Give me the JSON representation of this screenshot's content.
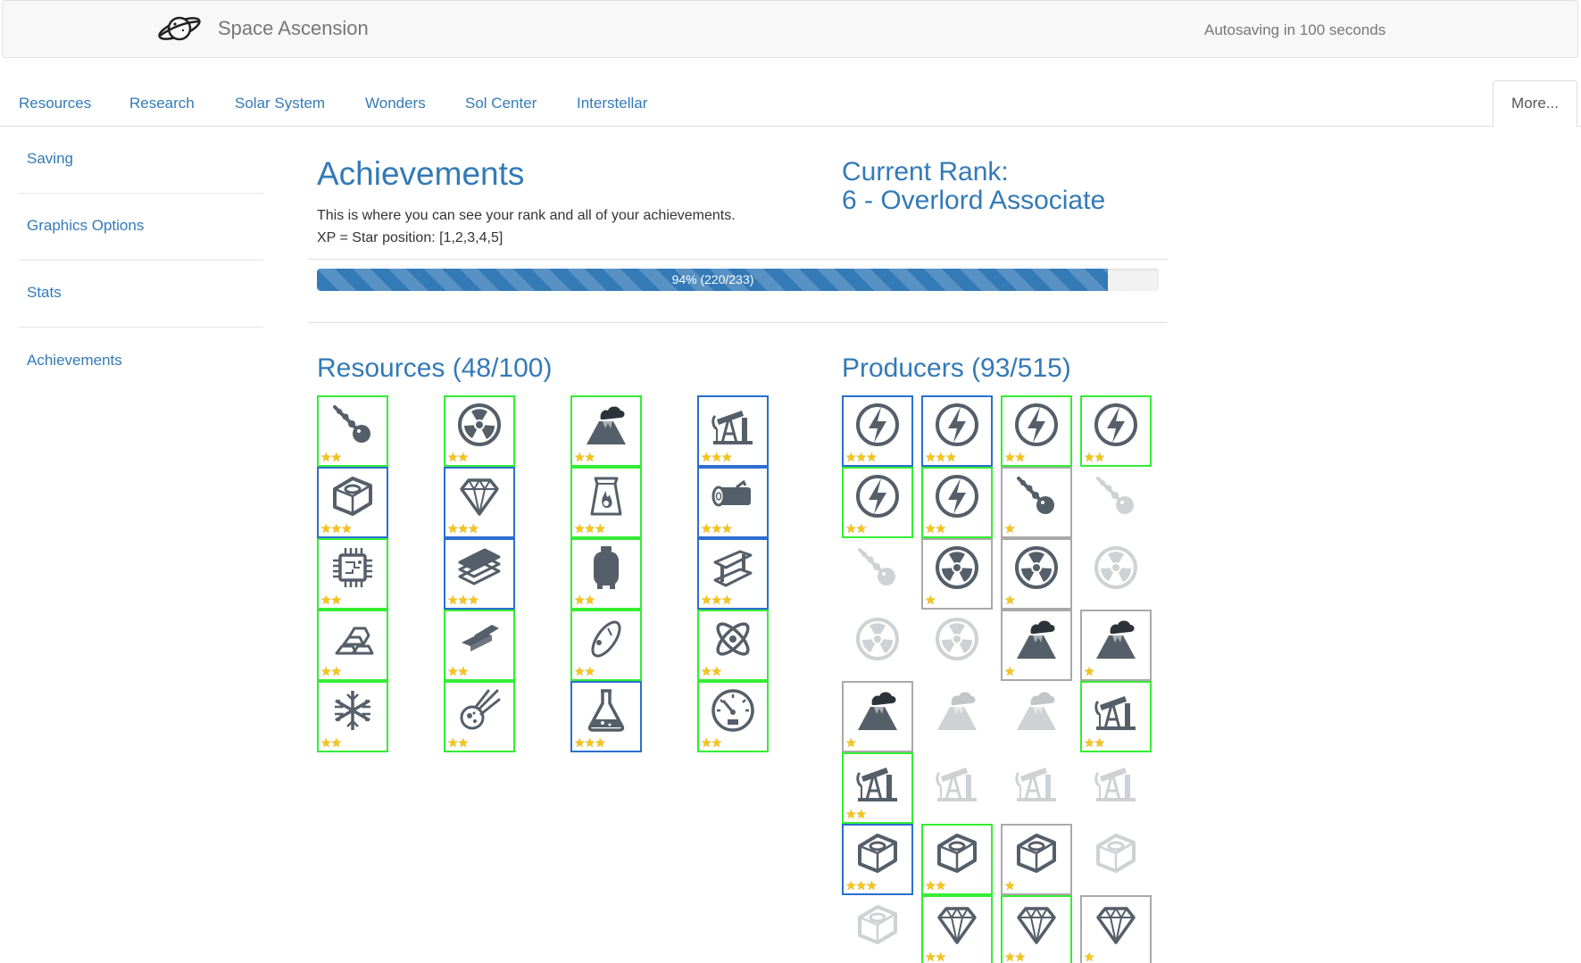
{
  "header": {
    "brand": "Space Ascension",
    "logo_icon": "planet-icon",
    "autosave": "Autosaving in 100 seconds"
  },
  "tabs": [
    {
      "label": "Resources"
    },
    {
      "label": "Research"
    },
    {
      "label": "Solar System"
    },
    {
      "label": "Wonders"
    },
    {
      "label": "Sol Center"
    },
    {
      "label": "Interstellar"
    }
  ],
  "tab_more": "More...",
  "sidebar": {
    "items": [
      {
        "label": "Saving"
      },
      {
        "label": "Graphics Options"
      },
      {
        "label": "Stats"
      },
      {
        "label": "Achievements"
      }
    ]
  },
  "achievements": {
    "title": "Achievements",
    "description": "This is where you can see your rank and all of your achievements.",
    "xp_note": "XP = Star position: [1,2,3,4,5]",
    "rank_label": "Current Rank:",
    "rank_value": "6 - Overlord Associate",
    "progress": {
      "fraction": 0.94,
      "text": "94% (220/233)"
    }
  },
  "resources": {
    "title": "Resources (48/100)",
    "items": [
      {
        "icon": "meteorite-icon",
        "stars": 2,
        "level": "green"
      },
      {
        "icon": "radiation-icon",
        "stars": 2,
        "level": "green"
      },
      {
        "icon": "volcano-icon",
        "stars": 2,
        "level": "green"
      },
      {
        "icon": "oil-pump-icon",
        "stars": 3,
        "level": "blue"
      },
      {
        "icon": "metal-nut-icon",
        "stars": 3,
        "level": "blue"
      },
      {
        "icon": "gem-icon",
        "stars": 3,
        "level": "blue"
      },
      {
        "icon": "charcoal-bag-icon",
        "stars": 3,
        "level": "green"
      },
      {
        "icon": "wood-log-icon",
        "stars": 3,
        "level": "blue"
      },
      {
        "icon": "silicon-chip-icon",
        "stars": 2,
        "level": "green"
      },
      {
        "icon": "plastic-sheets-icon",
        "stars": 3,
        "level": "blue"
      },
      {
        "icon": "gas-tank-icon",
        "stars": 2,
        "level": "green"
      },
      {
        "icon": "steel-beam-icon",
        "stars": 3,
        "level": "blue"
      },
      {
        "icon": "gold-bars-icon",
        "stars": 2,
        "level": "green"
      },
      {
        "icon": "silver-bars-icon",
        "stars": 2,
        "level": "green"
      },
      {
        "icon": "space-orbit-icon",
        "stars": 2,
        "level": "green"
      },
      {
        "icon": "atom-icon",
        "stars": 2,
        "level": "green"
      },
      {
        "icon": "snowflake-icon",
        "stars": 2,
        "level": "green"
      },
      {
        "icon": "comet-icon",
        "stars": 2,
        "level": "green"
      },
      {
        "icon": "science-flask-icon",
        "stars": 3,
        "level": "blue"
      },
      {
        "icon": "gauge-icon",
        "stars": 2,
        "level": "green"
      }
    ]
  },
  "producers": {
    "title": "Producers (93/515)",
    "items": [
      {
        "icon": "energy-icon",
        "stars": 3,
        "level": "blue"
      },
      {
        "icon": "energy-icon",
        "stars": 3,
        "level": "blue"
      },
      {
        "icon": "energy-icon",
        "stars": 2,
        "level": "green"
      },
      {
        "icon": "energy-icon",
        "stars": 2,
        "level": "green"
      },
      {
        "icon": "energy-icon",
        "stars": 2,
        "level": "green"
      },
      {
        "icon": "energy-icon",
        "stars": 2,
        "level": "green"
      },
      {
        "icon": "meteorite-icon",
        "stars": 1,
        "level": "grey"
      },
      {
        "icon": "meteorite-icon",
        "stars": 0,
        "level": "none"
      },
      {
        "icon": "meteorite-icon",
        "stars": 0,
        "level": "none"
      },
      {
        "icon": "radiation-icon",
        "stars": 1,
        "level": "grey"
      },
      {
        "icon": "radiation-icon",
        "stars": 1,
        "level": "grey"
      },
      {
        "icon": "radiation-icon",
        "stars": 0,
        "level": "none"
      },
      {
        "icon": "radiation-icon",
        "stars": 0,
        "level": "none"
      },
      {
        "icon": "radiation-icon",
        "stars": 0,
        "level": "none"
      },
      {
        "icon": "volcano-icon",
        "stars": 1,
        "level": "grey"
      },
      {
        "icon": "volcano-icon",
        "stars": 1,
        "level": "grey"
      },
      {
        "icon": "volcano-icon",
        "stars": 1,
        "level": "grey"
      },
      {
        "icon": "volcano-icon",
        "stars": 0,
        "level": "none"
      },
      {
        "icon": "volcano-icon",
        "stars": 0,
        "level": "none"
      },
      {
        "icon": "oil-pump-icon",
        "stars": 2,
        "level": "green"
      },
      {
        "icon": "oil-pump-icon",
        "stars": 2,
        "level": "green"
      },
      {
        "icon": "oil-pump-icon",
        "stars": 0,
        "level": "none"
      },
      {
        "icon": "oil-pump-icon",
        "stars": 0,
        "level": "none"
      },
      {
        "icon": "oil-pump-icon",
        "stars": 0,
        "level": "none"
      },
      {
        "icon": "metal-nut-icon",
        "stars": 3,
        "level": "blue"
      },
      {
        "icon": "metal-nut-icon",
        "stars": 2,
        "level": "green"
      },
      {
        "icon": "metal-nut-icon",
        "stars": 1,
        "level": "grey"
      },
      {
        "icon": "metal-nut-icon",
        "stars": 0,
        "level": "none"
      },
      {
        "icon": "metal-nut-icon",
        "stars": 0,
        "level": "none"
      },
      {
        "icon": "gem-icon",
        "stars": 2,
        "level": "green"
      },
      {
        "icon": "gem-icon",
        "stars": 2,
        "level": "green"
      },
      {
        "icon": "gem-icon",
        "stars": 1,
        "level": "grey"
      }
    ]
  },
  "colors": {
    "link": "#337ab7",
    "tier_green": "#33ee33",
    "tier_blue": "#2b6fcf",
    "tier_grey": "#a9a9a9",
    "star": "#f5c518",
    "icon": "#555f69"
  }
}
